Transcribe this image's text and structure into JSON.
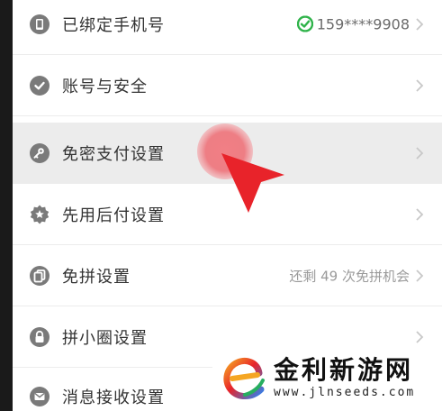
{
  "settings": {
    "items": [
      {
        "label": "已绑定手机号",
        "icon": "phone-icon",
        "value": "159****9908",
        "value_icon": "check-circle-icon"
      },
      {
        "label": "账号与安全",
        "icon": "shield-check-icon"
      },
      {
        "label": "免密支付设置",
        "icon": "key-icon",
        "highlighted": true
      },
      {
        "label": "先用后付设置",
        "icon": "star-badge-icon"
      },
      {
        "label": "免拼设置",
        "icon": "copy-icon",
        "value": "还剩 49 次免拼机会"
      },
      {
        "label": "拼小圈设置",
        "icon": "lock-icon"
      },
      {
        "label": "消息接收设置",
        "icon": "message-icon"
      }
    ]
  },
  "colors": {
    "accent_green": "#2fb34a",
    "pointer_red": "#e8232a",
    "highlight_bg": "#ececec",
    "icon_gray": "#7a7a7a"
  },
  "watermark": {
    "title": "金利新游网",
    "url": "www.jlnseeds.com"
  }
}
